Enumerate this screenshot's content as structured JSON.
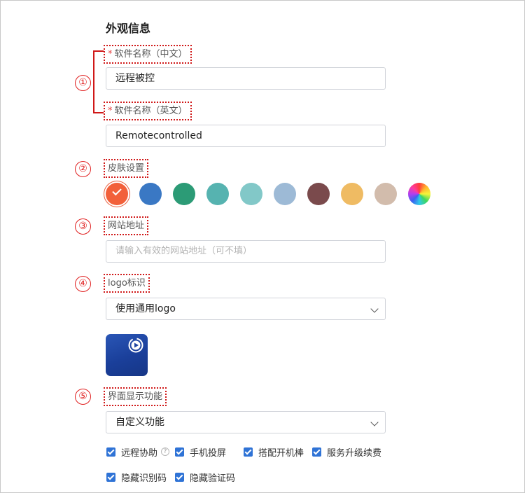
{
  "section_title": "外观信息",
  "markers": [
    "①",
    "②",
    "③",
    "④",
    "⑤"
  ],
  "software_name_cn": {
    "required_mark": "*",
    "label": "软件名称（中文）",
    "value": "远程被控"
  },
  "software_name_en": {
    "required_mark": "*",
    "label": "软件名称（英文）",
    "value": "Remotecontrolled"
  },
  "skin": {
    "label": "皮肤设置",
    "selected_index": 0,
    "colors": [
      "#f2603a",
      "#3a78c4",
      "#2c9b76",
      "#56b3b0",
      "#82c8c8",
      "#9dbad6",
      "#7a4a4c",
      "#efbb63",
      "#d2bcac",
      "rainbow"
    ]
  },
  "website": {
    "label": "网站地址",
    "placeholder": "请输入有效的网站地址（可不填）"
  },
  "logo": {
    "label": "logo标识",
    "selected": "使用通用logo",
    "preview_icon": "play-circle-icon"
  },
  "ui_features": {
    "label": "界面显示功能",
    "selected": "自定义功能",
    "options": [
      {
        "label": "远程协助",
        "checked": true,
        "has_help": true,
        "help_glyph": "?"
      },
      {
        "label": "手机投屏",
        "checked": true
      },
      {
        "label": "搭配开机棒",
        "checked": true
      },
      {
        "label": "服务升级续费",
        "checked": true
      },
      {
        "label": "隐藏识别码",
        "checked": true
      },
      {
        "label": "隐藏验证码",
        "checked": true
      }
    ]
  },
  "accent_color": "#2f73d6",
  "annotation_color": "#d01818"
}
